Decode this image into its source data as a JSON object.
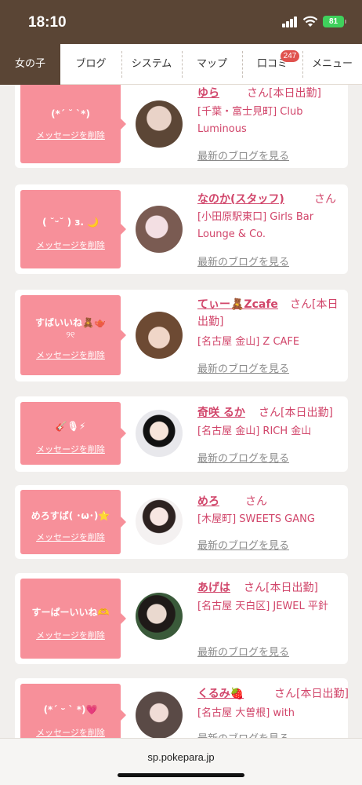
{
  "status_bar": {
    "time": "18:10",
    "battery": "81"
  },
  "nav": {
    "tabs": [
      {
        "label": "女の子",
        "active": true
      },
      {
        "label": "ブログ"
      },
      {
        "label": "システム"
      },
      {
        "label": "マップ"
      },
      {
        "label": "口コミ",
        "badge": "247"
      },
      {
        "label": "メニュー"
      }
    ]
  },
  "cards": [
    {
      "message": "(*´ ˘ `*)",
      "delete_label": "メッセージを削除",
      "name": "ゆら",
      "suffix": "さん[本日出勤]",
      "shop": "[千葉・富士見町] Club Luminous",
      "blog_label": "最新のブログを見る"
    },
    {
      "message": "( ˘ᵕ˘ ) з. 🌙",
      "delete_label": "メッセージを削除",
      "name": "なのか(スタッフ)",
      "suffix": "さん",
      "shop": "[小田原駅東口] Girls Bar Lounge & Co.",
      "blog_label": "最新のブログを見る"
    },
    {
      "message": "すばいいね🧸🫖",
      "message2": "୨୧",
      "delete_label": "メッセージを削除",
      "name": "てぃー🧸Zcafe",
      "suffix": "さん[本日出勤]",
      "shop": "[名古屋 金山] Z CAFE",
      "blog_label": "最新のブログを見る"
    },
    {
      "message": "🎸🎙⚡",
      "delete_label": "メッセージを削除",
      "name": "奇咲 るか",
      "suffix": "さん[本日出勤]",
      "shop": "[名古屋 金山] RICH 金山",
      "blog_label": "最新のブログを見る"
    },
    {
      "message": "めろすば( ･ω･)⭐",
      "delete_label": "メッセージを削除",
      "name": "めろ",
      "suffix": "さん",
      "shop": "[木屋町] SWEETS GANG",
      "blog_label": "最新のブログを見る"
    },
    {
      "message": "すーぱーいいね🫶",
      "delete_label": "メッセージを削除",
      "name": "あげは",
      "suffix": "さん[本日出勤]",
      "shop": "[名古屋 天白区] JEWEL 平針",
      "blog_label": "最新のブログを見る"
    },
    {
      "message": "(*´ ᵕ ` *)💗",
      "delete_label": "メッセージを削除",
      "name": "くるみ🍓",
      "suffix": "さん[本日出勤]",
      "shop": "[名古屋 大曽根] with",
      "blog_label": "最新のブログを見る"
    }
  ],
  "browser": {
    "url": "sp.pokepara.jp"
  },
  "colors": {
    "brand_brown": "#5a4535",
    "bubble_pink": "#f7909a",
    "name_pink": "#d1456a",
    "badge_red": "#e0524e"
  }
}
